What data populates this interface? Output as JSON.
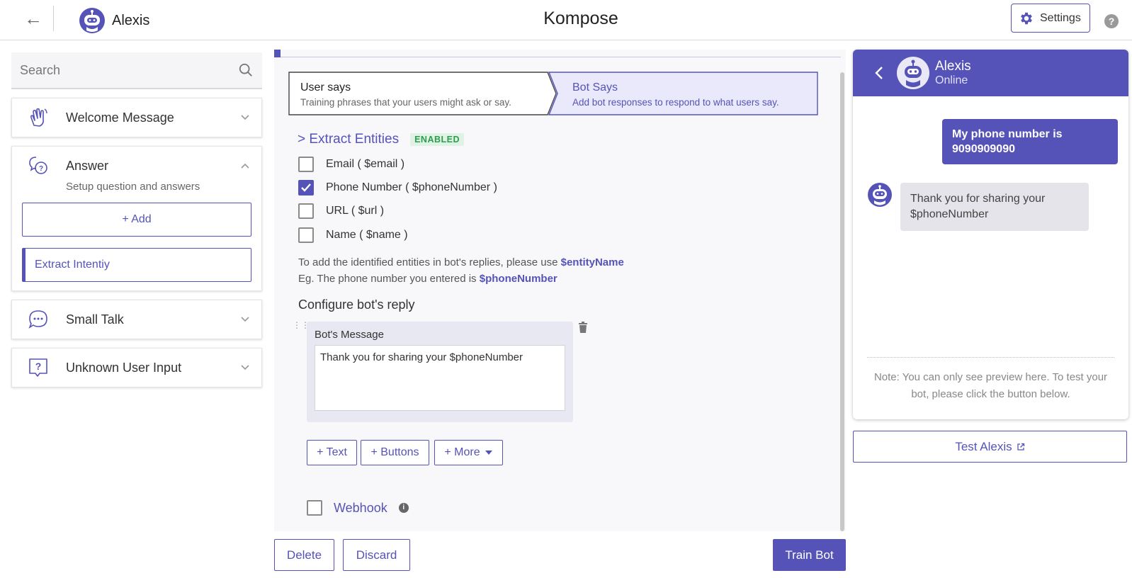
{
  "header": {
    "back_icon": "arrow-left-icon",
    "bot_name": "Alexis",
    "app_title": "Kompose",
    "settings_label": "Settings",
    "help_label": "?"
  },
  "sidebar": {
    "search_placeholder": "Search",
    "sections": [
      {
        "label": "Welcome Message",
        "icon": "hand-wave-icon",
        "expanded": false
      },
      {
        "label": "Answer",
        "icon": "question-chat-icon",
        "expanded": true,
        "subtitle": "Setup question and answers",
        "add_label": "+ Add",
        "items": [
          "Extract Intentiy"
        ]
      },
      {
        "label": "Small Talk",
        "icon": "chat-dots-icon",
        "expanded": false
      },
      {
        "label": "Unknown User Input",
        "icon": "question-box-icon",
        "expanded": false
      }
    ]
  },
  "main": {
    "steps": [
      {
        "title": "User says",
        "description": "Training phrases that your users might ask or say."
      },
      {
        "title": "Bot Says",
        "description": "Add bot responses to respond to what users say."
      }
    ],
    "extract": {
      "title": "> Extract Entities",
      "badge": "ENABLED",
      "entities": [
        {
          "label": "Email ( $email )",
          "checked": false
        },
        {
          "label": "Phone Number ( $phoneNumber )",
          "checked": true
        },
        {
          "label": "URL ( $url )",
          "checked": false
        },
        {
          "label": "Name ( $name )",
          "checked": false
        }
      ],
      "hint1_prefix": "To add the identified entities in bot's replies, please use ",
      "hint1_var": "$entityName",
      "hint2_prefix": "Eg. The phone number you entered is ",
      "hint2_var": "$phoneNumber"
    },
    "config_title": "Configure bot's reply",
    "message": {
      "label": "Bot's Message",
      "value": "Thank you for sharing your $phoneNumber"
    },
    "add_buttons": {
      "text": "+ Text",
      "buttons": "+ Buttons",
      "more": "+ More"
    },
    "webhook_label": "Webhook",
    "footer": {
      "delete": "Delete",
      "discard": "Discard",
      "train": "Train Bot"
    }
  },
  "preview": {
    "bot_name": "Alexis",
    "status": "Online",
    "user_message": "My phone number is 9090909090",
    "bot_message": "Thank you for sharing your $phoneNumber",
    "note": "Note: You can only see preview here. To test your bot, please click the button below.",
    "test_label": "Test Alexis"
  },
  "colors": {
    "accent": "#5553b7",
    "enabled_bg": "#dff3e4",
    "enabled_text": "#2e9b4e"
  }
}
